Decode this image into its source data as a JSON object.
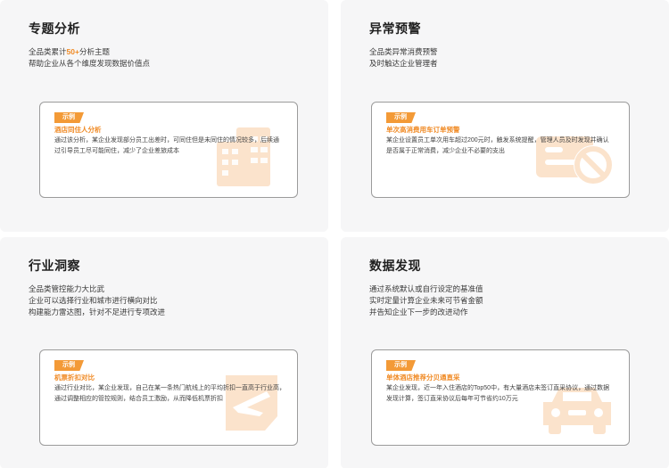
{
  "cards": [
    {
      "title": "专题分析",
      "desc": {
        "l1_pre": "全品类累计",
        "l1_highlight": "50+",
        "l1_post": "分析主题",
        "l2": "帮助企业从各个维度发现数据价值点"
      },
      "example": {
        "badge": "示例",
        "title": "酒店同住人分析",
        "lines": [
          "通过该分析，某企业发现部分员工出差时，可同住但是未同住的情况较多，后续通",
          "过引导员工尽可能同住，减少了企业差旅成本"
        ]
      },
      "icon": "building-icon"
    },
    {
      "title": "异常预警",
      "desc": {
        "l1": "全品类异常消费预警",
        "l2": "及时触达企业管理者"
      },
      "example": {
        "badge": "示例",
        "title": "单次高消费用车订单预警",
        "lines": [
          "某企业设置员工单次用车超过200元时，触发系统提醒，管理人员及时发现并确认",
          "是否属于正常消费，减少企业不必要的支出"
        ]
      },
      "icon": "car-forbidden-icon"
    },
    {
      "title": "行业洞察",
      "desc": {
        "l1": "全品类管控能力大比武",
        "l2": "企业可以选择行业和城市进行横向对比",
        "l3": "构建能力雷达图，针对不足进行专项改进"
      },
      "example": {
        "badge": "示例",
        "title": "机票折扣对比",
        "lines": [
          "通过行业对比，某企业发现，自己在某一条热门航线上的平均折扣一直高于行业高，",
          "通过调整相应的管控规则，结合员工激励，从而降低机票折扣"
        ]
      },
      "icon": "plane-ticket-icon"
    },
    {
      "title": "数据发现",
      "desc": {
        "l1": "通过系统默认或自行设定的基准值",
        "l2": "实时定量计算企业未来可节省金额",
        "l3": "并告知企业下一步的改进动作"
      },
      "example": {
        "badge": "示例",
        "title": "单体酒店推荐分贝通直采",
        "lines": [
          "某企业发现，近一年入住酒店的Top50中，有大量酒店未签订直采协议，通过数据",
          "发现计算，签订直采协议后每年可节省约10万元"
        ]
      },
      "icon": "car-icon"
    }
  ],
  "colors": {
    "accent": "#f08a24",
    "badge": "#f39a37",
    "watermark": "#fbe3cc"
  }
}
